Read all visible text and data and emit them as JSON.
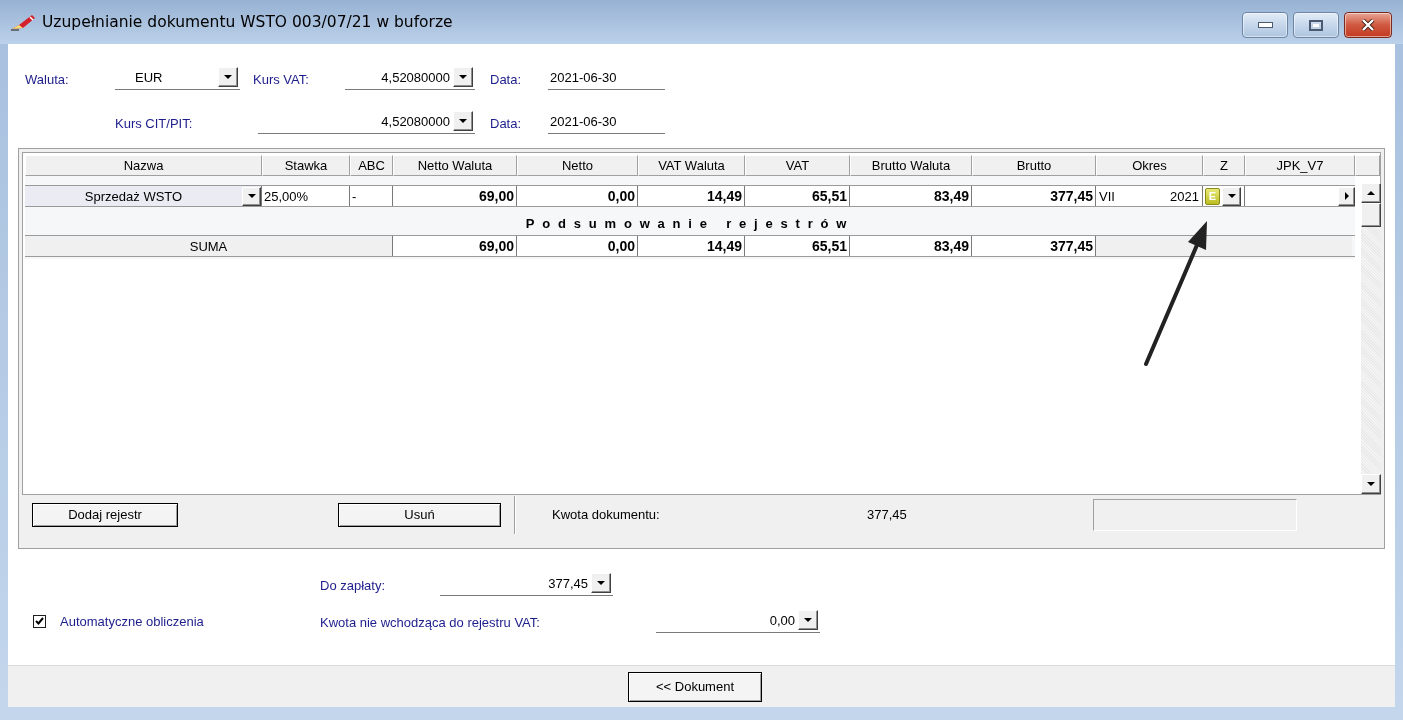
{
  "window": {
    "title": "Uzupełnianie dokumentu WSTO 003/07/21 w buforze"
  },
  "currency": {
    "waluta": {
      "label": "Waluta:",
      "value": "EUR"
    },
    "kurs_vat": {
      "label": "Kurs VAT:",
      "value": "4,52080000"
    },
    "data_vat": {
      "label": "Data:",
      "value": "2021-06-30"
    },
    "kurs_cit_pit": {
      "label": "Kurs CIT/PIT:",
      "value": "4,52080000"
    },
    "data_cit_pit": {
      "label": "Data:",
      "value": "2021-06-30"
    }
  },
  "registers": {
    "columns": [
      "Nazwa",
      "Stawka",
      "ABC",
      "Netto Waluta",
      "Netto",
      "VAT Waluta",
      "VAT",
      "Brutto Waluta",
      "Brutto",
      "Okres",
      "Z",
      "JPK_V7"
    ],
    "rows": [
      {
        "nazwa": "Sprzedaż WSTO",
        "stawka": "25,00%",
        "abc": "-",
        "netto_waluta": "69,00",
        "netto": "0,00",
        "vat_waluta": "14,49",
        "vat": "65,51",
        "brutto_waluta": "83,49",
        "brutto": "377,45",
        "okres_month": "VII",
        "okres_year": "2021",
        "z": "E"
      }
    ],
    "summary_title": "Podsumowanie rejestrów",
    "summary": {
      "label": "SUMA",
      "values": [
        "69,00",
        "0,00",
        "14,49",
        "65,51",
        "83,49",
        "377,45"
      ]
    },
    "buttons": [
      "Dodaj rejestr",
      "Usuń"
    ],
    "document_amount": {
      "label": "Kwota dokumentu:",
      "value": "377,45"
    }
  },
  "payment": {
    "label": "Do zapłaty:",
    "value": "377,45"
  },
  "auto_calc": {
    "label": "Automatyczne obliczenia",
    "checked": true
  },
  "non_vat_amount": {
    "label": "Kwota nie wchodząca do rejestru VAT:",
    "value": "0,00"
  },
  "footer_button": "<< Dokument"
}
